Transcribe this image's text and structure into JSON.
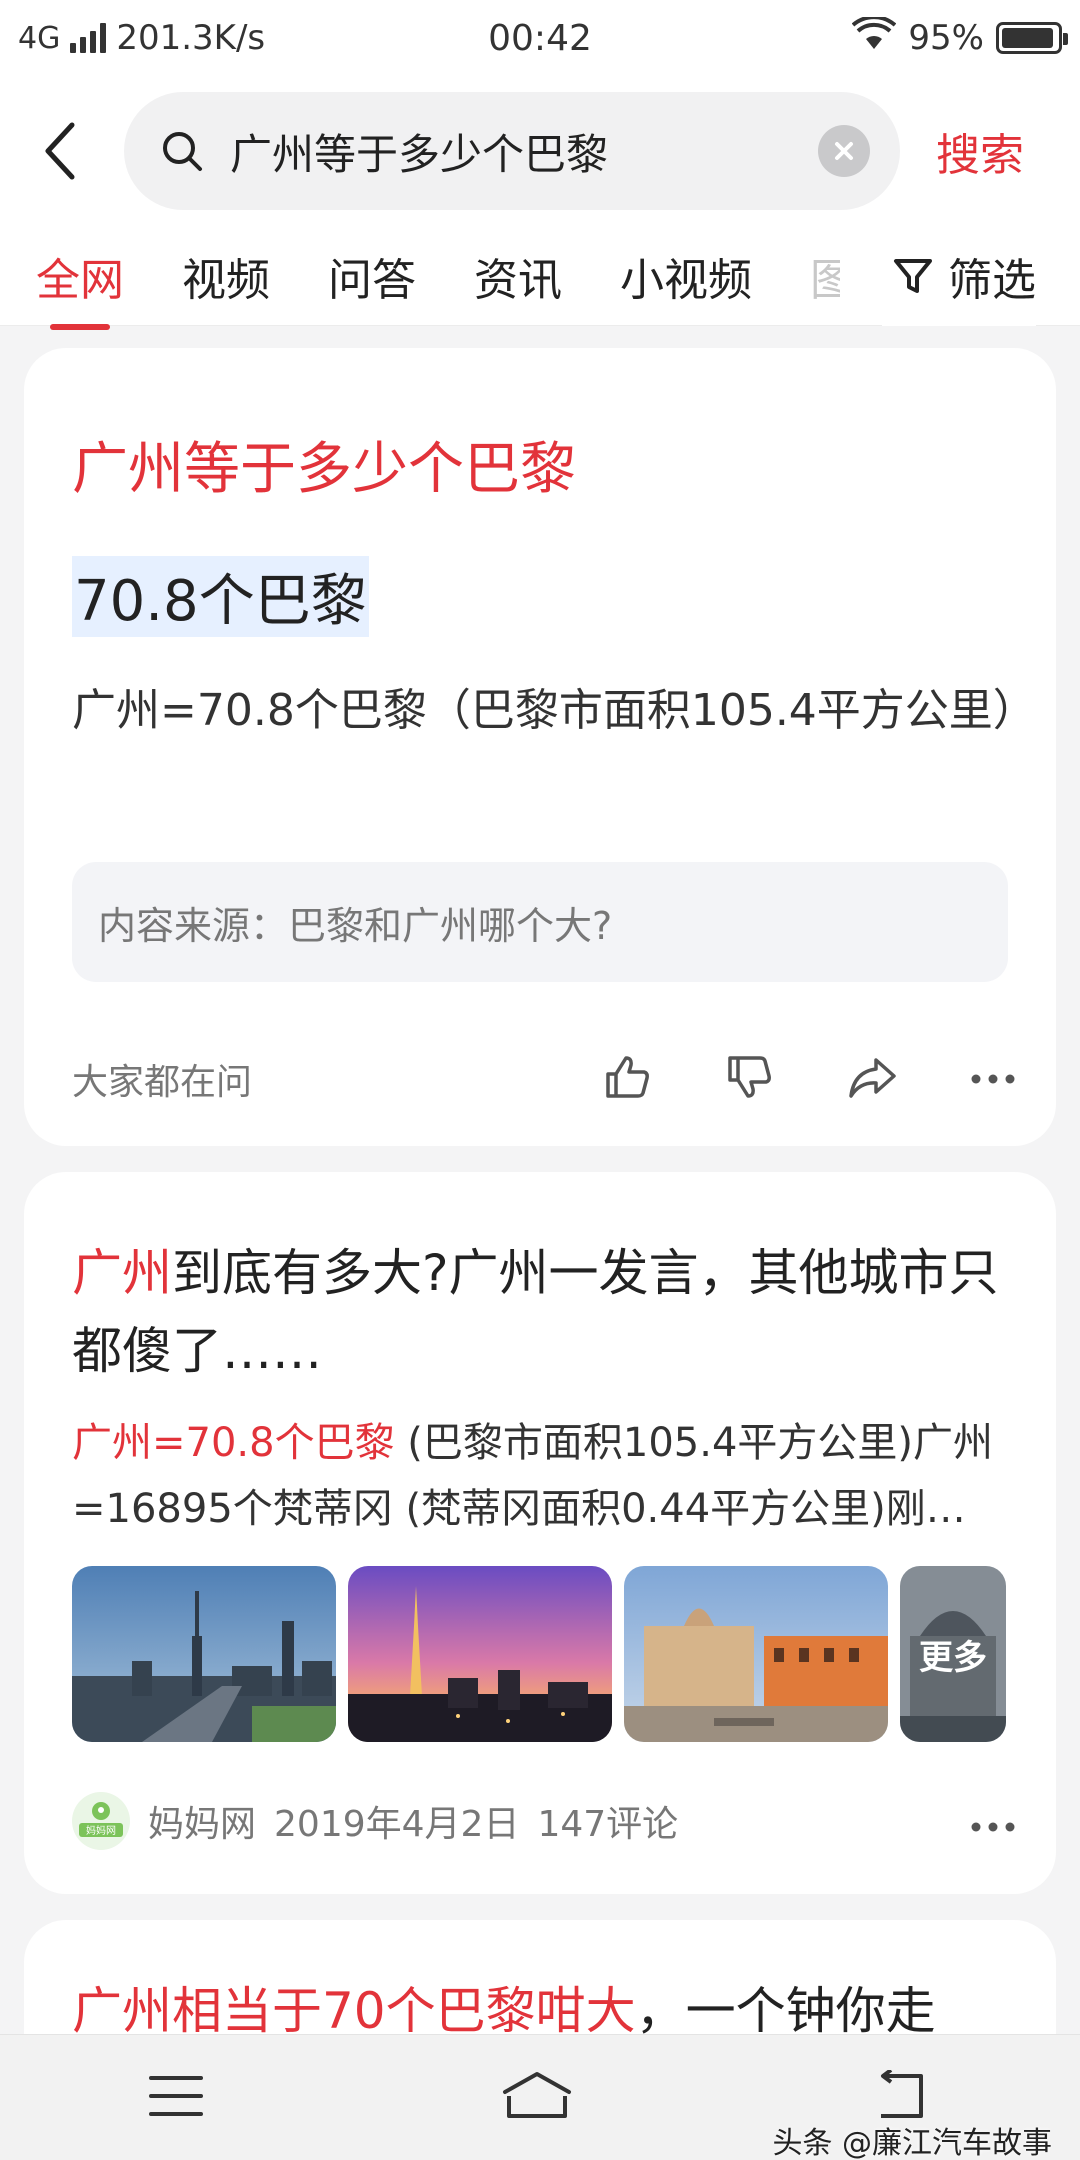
{
  "status_bar": {
    "network": "4G",
    "speed": "201.3K/s",
    "time": "00:42",
    "battery": "95%",
    "battery_level": 0.95
  },
  "search": {
    "query": "广州等于多少个巴黎",
    "submit_label": "搜索"
  },
  "tabs": [
    {
      "label": "全网",
      "active": true
    },
    {
      "label": "视频",
      "active": false
    },
    {
      "label": "问答",
      "active": false
    },
    {
      "label": "资讯",
      "active": false
    },
    {
      "label": "小视频",
      "active": false
    },
    {
      "label": "图",
      "active": false
    }
  ],
  "filter_label": "筛选",
  "answer_card": {
    "title": "广州等于多少个巴黎",
    "value": "70.8个巴黎",
    "description": "广州=70.8个巴黎（巴黎市面积105.4平方公里）",
    "source": "内容来源：巴黎和广州哪个大?",
    "footer_label": "大家都在问"
  },
  "article_card": {
    "title_highlight": "广州",
    "title_rest": "到底有多大?广州一发言，其他城市只都傻了……",
    "snippet_highlight": "广州=70.8个巴黎",
    "snippet_rest": " (巴黎市面积105.4平方公里)广州=16895个梵蒂冈 (梵蒂冈面积0.44平方公里)刚…",
    "more_label": "更多",
    "source_name": "妈妈网",
    "source_logo_text": "妈妈网",
    "date": "2019年4月2日",
    "comments": "147评论"
  },
  "partial_card": {
    "title_highlight": "广州相当于70个巴黎咁大",
    "title_rest": "，一个钟你走"
  },
  "watermark": "头条 @廉江汽车故事",
  "colors": {
    "accent": "#e2333a",
    "background": "#f4f4f5"
  }
}
